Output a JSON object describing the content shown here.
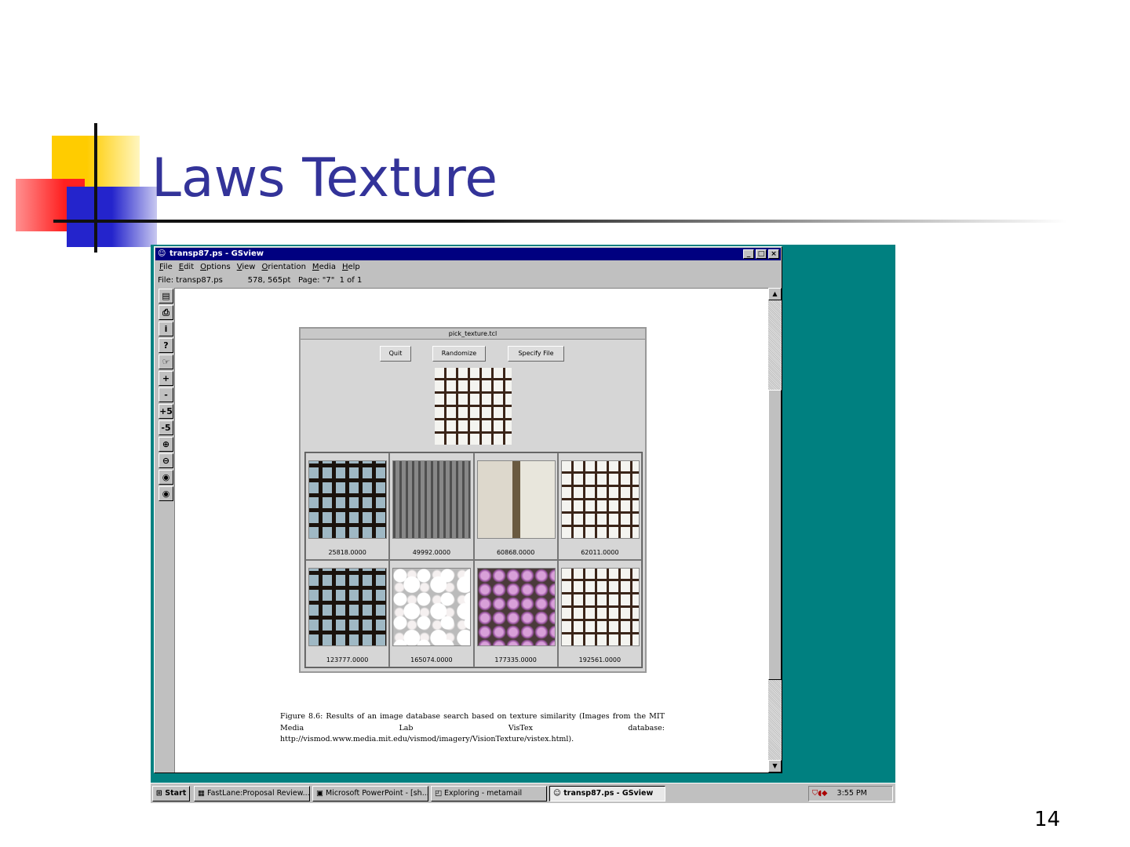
{
  "slide": {
    "title": "Laws Texture",
    "page_number": "14"
  },
  "gsview": {
    "title": "transp87.ps - GSview",
    "menu": [
      "File",
      "Edit",
      "Options",
      "View",
      "Orientation",
      "Media",
      "Help"
    ],
    "status": {
      "file": "File: transp87.ps",
      "coords": "578, 565pt",
      "page": "Page: \"7\"  1 of 1"
    },
    "toolbar": [
      "open-icon",
      "print-icon",
      "info-icon",
      "help-icon",
      "goto-page-icon",
      "next-page-icon",
      "prev-page-icon",
      "skip-forward-5-icon",
      "skip-back-5-icon",
      "zoom-in-icon",
      "zoom-out-icon",
      "eps-preview-icon",
      "display-settings-icon"
    ],
    "toolbar_glyphs": [
      "▤",
      "⎙",
      "i",
      "?",
      "☞",
      "+",
      "-",
      "+5",
      "-5",
      "⊕",
      "⊖",
      "◉",
      "◉"
    ]
  },
  "pick_texture": {
    "title": "pick_texture.tcl",
    "buttons": {
      "quit": "Quit",
      "randomize": "Randomize",
      "specify": "Specify File"
    },
    "results": [
      {
        "score": "25818.0000",
        "texture": "grid-blue"
      },
      {
        "score": "49992.0000",
        "texture": "bldg"
      },
      {
        "score": "60868.0000",
        "texture": "wood"
      },
      {
        "score": "62011.0000",
        "texture": "grid-tex"
      },
      {
        "score": "123777.0000",
        "texture": "grid-blue"
      },
      {
        "score": "165074.0000",
        "texture": "white-fl"
      },
      {
        "score": "177335.0000",
        "texture": "pink-fl"
      },
      {
        "score": "192561.0000",
        "texture": "grid-tex"
      }
    ]
  },
  "caption": "Figure 8.6: Results of an image database search based on texture similarity (Images from the MIT Media Lab VisTex database: http://vismod.www.media.mit.edu/vismod/imagery/VisionTexture/vistex.html).",
  "taskbar": {
    "start": "Start",
    "tasks": [
      "FastLane:Proposal Review...",
      "Microsoft PowerPoint - [sh...",
      "Exploring - metamail",
      "transp87.ps - GSview"
    ],
    "clock": "3:55 PM"
  }
}
